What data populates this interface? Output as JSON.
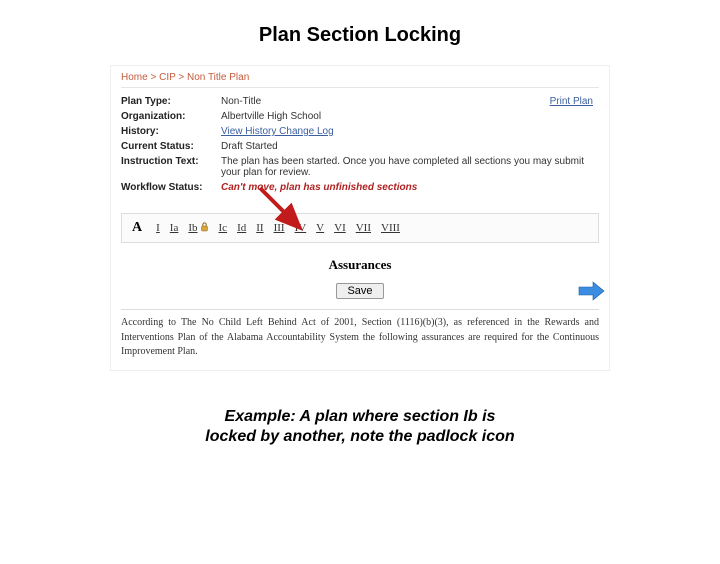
{
  "title": "Plan Section Locking",
  "breadcrumb": [
    "Home",
    "CIP",
    "Non Title Plan"
  ],
  "print_link": "Print Plan",
  "meta": {
    "plan_type_label": "Plan Type:",
    "plan_type_value": "Non-Title",
    "organization_label": "Organization:",
    "organization_value": "Albertville High School",
    "history_label": "History:",
    "history_value": "View History Change Log",
    "current_status_label": "Current Status:",
    "current_status_value": "Draft Started",
    "instruction_text_label": "Instruction Text:",
    "instruction_text_value": "The plan has been started. Once you have completed all sections you may submit your plan for review.",
    "workflow_status_label": "Workflow Status:",
    "workflow_status_value": "Can't move, plan has unfinished sections"
  },
  "section_prefix": "A",
  "sections": [
    "I",
    "Ia",
    "Ib",
    "Ic",
    "Id",
    "II",
    "III",
    "IV",
    "V",
    "VI",
    "VII",
    "VIII"
  ],
  "locked_section": "Ib",
  "panel_title": "Assurances",
  "save_button": "Save",
  "assurance_body": "According to The No Child Left Behind Act of 2001, Section (1116)(b)(3), as referenced in the Rewards and Interventions Plan of the Alabama Accountability System the following assurances are required for the Continuous Improvement Plan.",
  "caption_line1": "Example:  A plan where section Ib is",
  "caption_line2": "locked by another, note the padlock icon"
}
